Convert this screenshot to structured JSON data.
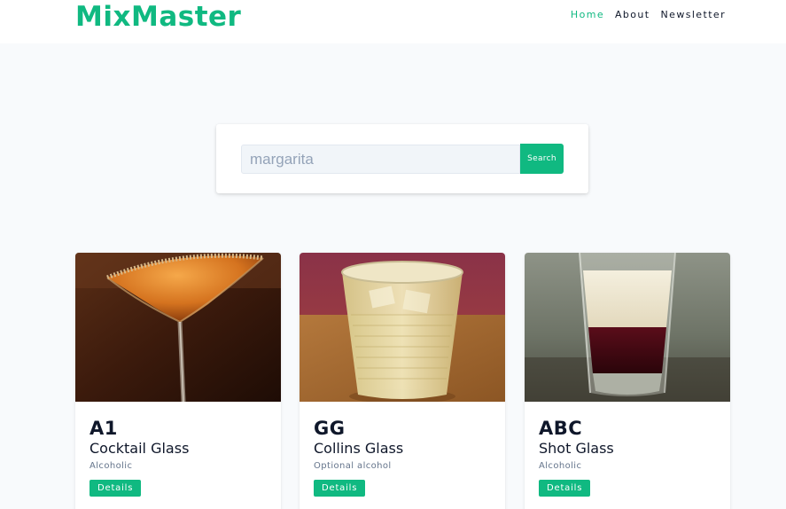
{
  "header": {
    "logo": "MixMaster",
    "nav": [
      {
        "label": "Home",
        "active": true
      },
      {
        "label": "About",
        "active": false
      },
      {
        "label": "Newsletter",
        "active": false
      }
    ]
  },
  "search": {
    "value": "margarita",
    "button_label": "Search"
  },
  "cocktails": [
    {
      "name": "A1",
      "glass": "Cocktail Glass",
      "info": "Alcoholic",
      "button_label": "Details",
      "image": "cocktail-glass-orange-drink"
    },
    {
      "name": "GG",
      "glass": "Collins Glass",
      "info": "Optional alcohol",
      "button_label": "Details",
      "image": "collins-glass-ice-drink"
    },
    {
      "name": "ABC",
      "glass": "Shot Glass",
      "info": "Alcoholic",
      "button_label": "Details",
      "image": "layered-shot-glass"
    }
  ],
  "colors": {
    "accent": "#10b981",
    "background": "#f8fafc",
    "text": "#0f172a",
    "muted": "#64748b"
  }
}
